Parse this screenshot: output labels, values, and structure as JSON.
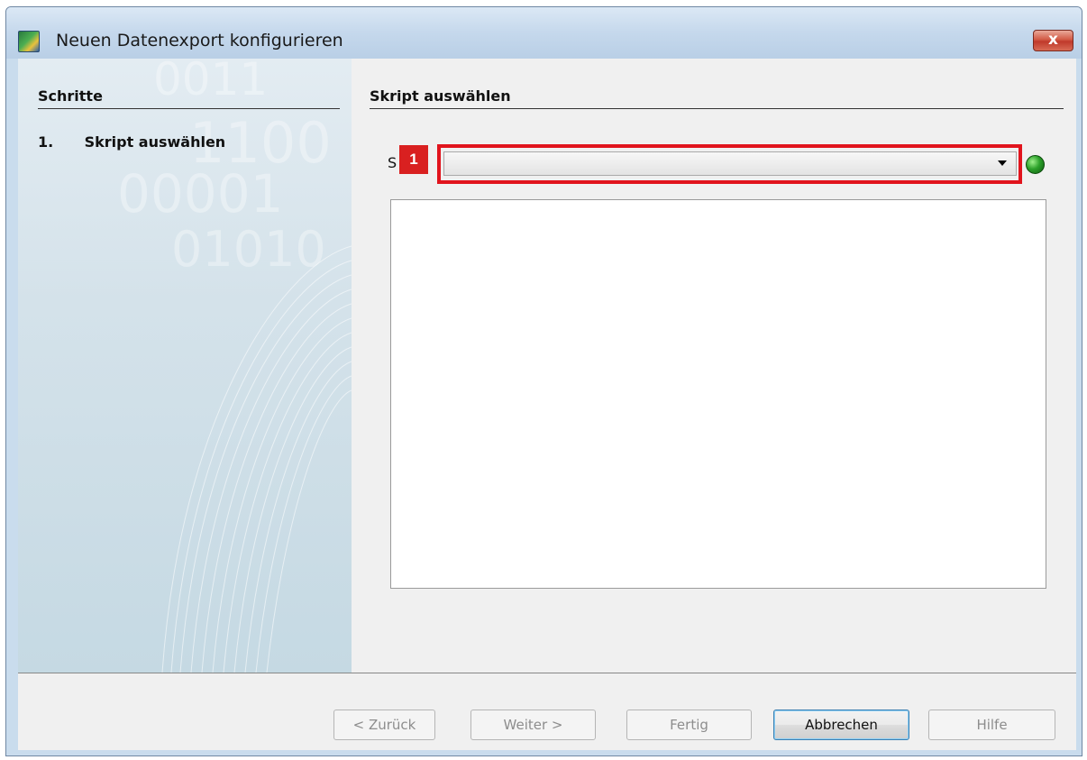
{
  "window": {
    "title": "Neuen Datenexport konfigurieren",
    "close_label": "x"
  },
  "sidebar": {
    "heading": "Schritte",
    "steps": [
      {
        "number": "1.",
        "label": "Skript auswählen"
      }
    ]
  },
  "main": {
    "heading": "Skript auswählen",
    "script_label": "S",
    "badge": "1",
    "combo_value": "",
    "status_color": "#2ca12a"
  },
  "footer": {
    "back_label": "< Zurück",
    "next_label": "Weiter >",
    "finish_label": "Fertig",
    "cancel_label": "Abbrechen",
    "help_label": "Hilfe"
  },
  "colors": {
    "highlight": "#e1141d",
    "badge": "#d92020"
  }
}
